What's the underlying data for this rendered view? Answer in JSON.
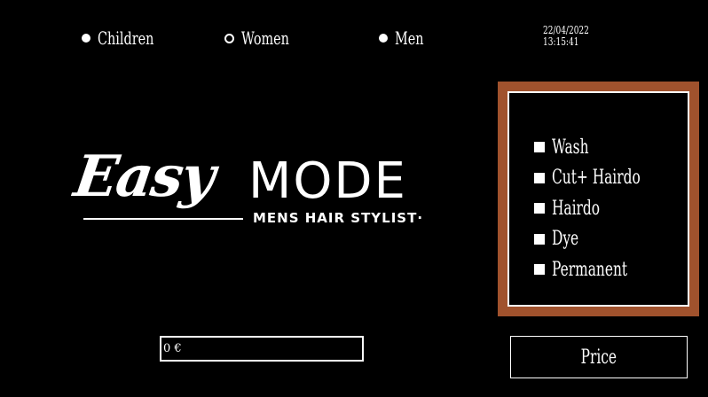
{
  "categories": [
    {
      "label": "Children",
      "selected": false
    },
    {
      "label": "Women",
      "selected": true
    },
    {
      "label": "Men",
      "selected": false
    }
  ],
  "datetime": {
    "date": "22/04/2022",
    "time": "13:15:41"
  },
  "logo": {
    "script_text": "Easy",
    "bold_text": "MODE",
    "subtitle": "MENS HAIR STYLIST·"
  },
  "services": [
    {
      "label": "Wash"
    },
    {
      "label": "Cut+ Hairdo"
    },
    {
      "label": "Hairdo"
    },
    {
      "label": "Dye"
    },
    {
      "label": "Permanent"
    }
  ],
  "total": {
    "value": "0 €"
  },
  "price_button": {
    "label": "Price"
  },
  "colors": {
    "background": "#000000",
    "frame": "#a0522d",
    "foreground": "#ffffff"
  }
}
